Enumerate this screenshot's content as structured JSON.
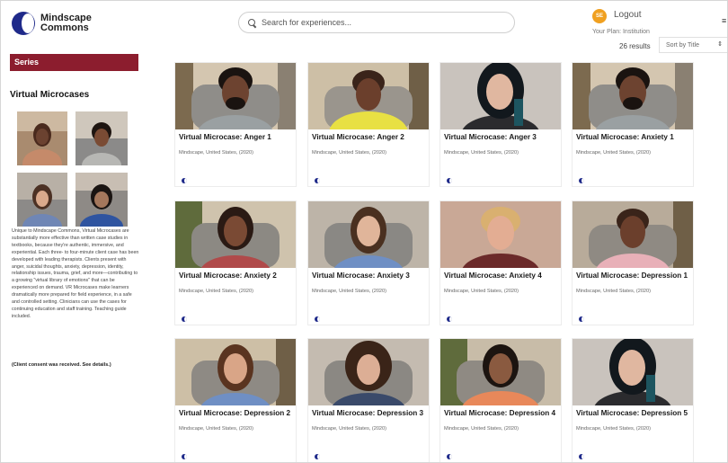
{
  "brand": {
    "line1": "Mindscape",
    "line2": "Commons"
  },
  "search": {
    "placeholder": "Search for experiences..."
  },
  "account": {
    "initials": "SE",
    "logout_label": "Logout",
    "plan": "Your Plan: Institution",
    "avatar_color": "#f0a020"
  },
  "results": {
    "count_label": "26 results",
    "sort_label": "Sort by Title",
    "sort_caret": "⇕"
  },
  "sidebar": {
    "section_label": "Series",
    "title": "Virtual Microcases",
    "description": "Unique to Mindscape Commons, Virtual Microcases are substantially more effective than written case studies in textbooks, because they're authentic, immersive, and experiential. Each three- to four-minute client case has been developed with leading therapists. Clients present with anger, suicidal thoughts, anxiety, depression, identity, relationship issues, trauma, grief, and more—contributing to a growing \"virtual library of emotions\" that can be experienced on demand. VR Microcases make learners dramatically more prepared for field experience, in a safe and controlled setting. Clinicians can use the cases for continuing education and staff training. Teaching guide included.",
    "consent": "(Client consent was received. See details.)",
    "accent_color": "#8c1d2e"
  },
  "cards": [
    {
      "title": "Virtual Microcase: Anger 1",
      "meta": "Mindscape, United States, (2020)"
    },
    {
      "title": "Virtual Microcase: Anger 2",
      "meta": "Mindscape, United States, (2020)"
    },
    {
      "title": "Virtual Microcase: Anger 3",
      "meta": "Mindscape, United States, (2020)"
    },
    {
      "title": "Virtual Microcase: Anxiety 1",
      "meta": "Mindscape, United States, (2020)"
    },
    {
      "title": "Virtual Microcase: Anxiety 2",
      "meta": "Mindscape, United States, (2020)"
    },
    {
      "title": "Virtual Microcase: Anxiety 3",
      "meta": "Mindscape, United States, (2020)"
    },
    {
      "title": "Virtual Microcase: Anxiety 4",
      "meta": "Mindscape, United States, (2020)"
    },
    {
      "title": "Virtual Microcase: Depression 1",
      "meta": "Mindscape, United States, (2020)"
    },
    {
      "title": "Virtual Microcase: Depression 2",
      "meta": "Mindscape, United States, (2020)"
    },
    {
      "title": "Virtual Microcase: Depression 3",
      "meta": "Mindscape, United States, (2020)"
    },
    {
      "title": "Virtual Microcase: Depression 4",
      "meta": "Mindscape, United States, (2020)"
    },
    {
      "title": "Virtual Microcase: Depression 5",
      "meta": "Mindscape, United States, (2020)"
    }
  ],
  "icons": {
    "logo": "mindscape-logo-icon",
    "search": "search-icon",
    "media_type": "media-type-icon"
  },
  "colors": {
    "brand_blue": "#1f2a8a",
    "accent_red": "#8c1d2e"
  }
}
